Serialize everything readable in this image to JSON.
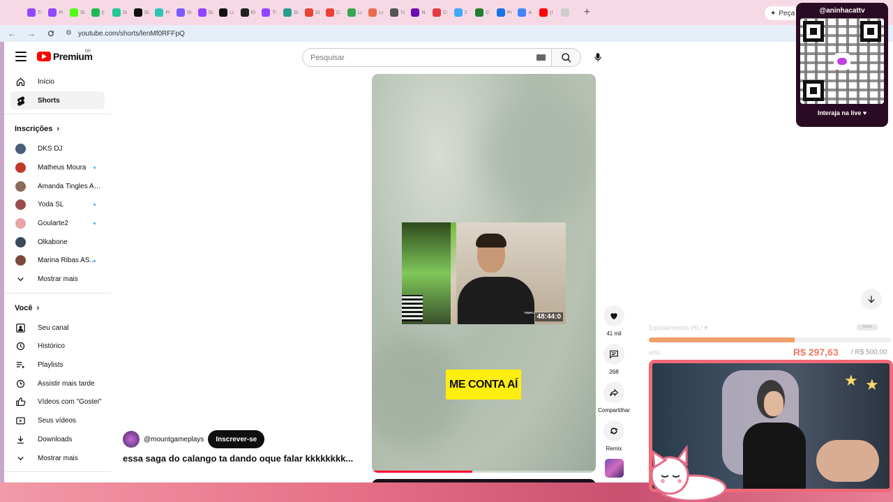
{
  "browser": {
    "url": "youtube.com/shorts/lenMf0RFFpQ",
    "ask_button": "Peça ao",
    "tabs": [
      {
        "color": "#9147ff",
        "label": "Tv"
      },
      {
        "color": "#9147ff",
        "label": "Pc"
      },
      {
        "color": "#53fc18",
        "label": "St"
      },
      {
        "color": "#1db954",
        "label": "(I"
      },
      {
        "color": "#20c997",
        "label": "Di"
      },
      {
        "color": "#111111",
        "label": "St"
      },
      {
        "color": "#2ec4b6",
        "label": "Pr"
      },
      {
        "color": "#7c5cff",
        "label": "St"
      },
      {
        "color": "#9147ff",
        "label": "St"
      },
      {
        "color": "#111111",
        "label": "Lc"
      },
      {
        "color": "#222222",
        "label": "El"
      },
      {
        "color": "#9147ff",
        "label": "Tv"
      },
      {
        "color": "#2a9d8f",
        "label": "St"
      },
      {
        "color": "#ea4335",
        "label": "31"
      },
      {
        "color": "#ea4335",
        "label": "Ca"
      },
      {
        "color": "#34a853",
        "label": "Lc"
      },
      {
        "color": "#e76f51",
        "label": "Lc"
      },
      {
        "color": "#555555",
        "label": "7z"
      },
      {
        "color": "#6a0dad",
        "label": "N"
      },
      {
        "color": "#e63946",
        "label": "Cc"
      },
      {
        "color": "#3fa9f5",
        "label": "2"
      },
      {
        "color": "#1e7e34",
        "label": "Cc"
      },
      {
        "color": "#1a73e8",
        "label": "Pr"
      },
      {
        "color": "#4285f4",
        "label": "A"
      },
      {
        "color": "#ff0000",
        "label": "(I"
      },
      {
        "color": "#cccccc",
        "label": ""
      }
    ]
  },
  "youtube": {
    "logo_text": "Premium",
    "logo_country": "BR",
    "search_placeholder": "Pesquisar",
    "sidebar": {
      "primary": [
        {
          "label": "Início",
          "icon": "home-icon"
        },
        {
          "label": "Shorts",
          "icon": "shorts-icon",
          "active": true
        }
      ],
      "subscriptions_title": "Inscrições",
      "subscriptions": [
        {
          "label": "DKS DJ",
          "color": "#4a5d7a",
          "dot": false
        },
        {
          "label": "Matheus Moura",
          "color": "#c0392b",
          "dot": true
        },
        {
          "label": "Amanda Tingles AS...",
          "color": "#8a6a5a",
          "dot": false
        },
        {
          "label": "Yoda SL",
          "color": "#9b4d4d",
          "dot": true
        },
        {
          "label": "Goularte2",
          "color": "#e8a3a3",
          "dot": true
        },
        {
          "label": "Olkabone",
          "color": "#3a4a5a",
          "dot": false
        },
        {
          "label": "Marina Ribas AS...",
          "color": "#7a4a3a",
          "dot": true
        }
      ],
      "subscriptions_more": "Mostrar mais",
      "you_title": "Você",
      "you": [
        {
          "label": "Seu canal",
          "icon": "channel-icon"
        },
        {
          "label": "Histórico",
          "icon": "history-icon"
        },
        {
          "label": "Playlists",
          "icon": "playlist-icon"
        },
        {
          "label": "Assistir mais tarde",
          "icon": "watch-later-icon"
        },
        {
          "label": "Vídeos com \"Gostei\"",
          "icon": "like-icon"
        },
        {
          "label": "Seus vídeos",
          "icon": "your-videos-icon"
        },
        {
          "label": "Downloads",
          "icon": "download-icon"
        }
      ],
      "you_more": "Mostrar mais"
    },
    "short": {
      "caption": "ME CONTA AÍ",
      "timer_label": "TEMPO RESTANTE",
      "timer": "48:44:0",
      "progress": 0.45,
      "channel": "@mountgameplays",
      "subscribe": "Inscrever-se",
      "title": "essa saga do calango ta dando oque falar kkkkkkkk...",
      "likes": "41 mil",
      "comments": "268",
      "share": "Compartilhar",
      "remix": "Remix"
    }
  },
  "overlay": {
    "handle": "@aninhacattv",
    "cta": "Interaja na live ♥",
    "goal_label": "Equipamentos IRL! ♥",
    "goal_tag": "Meta",
    "goal_percent_text": "60%",
    "goal_progress": 0.6,
    "goal_amount": "R$ 297,63",
    "goal_target": "/ R$ 500,00"
  }
}
